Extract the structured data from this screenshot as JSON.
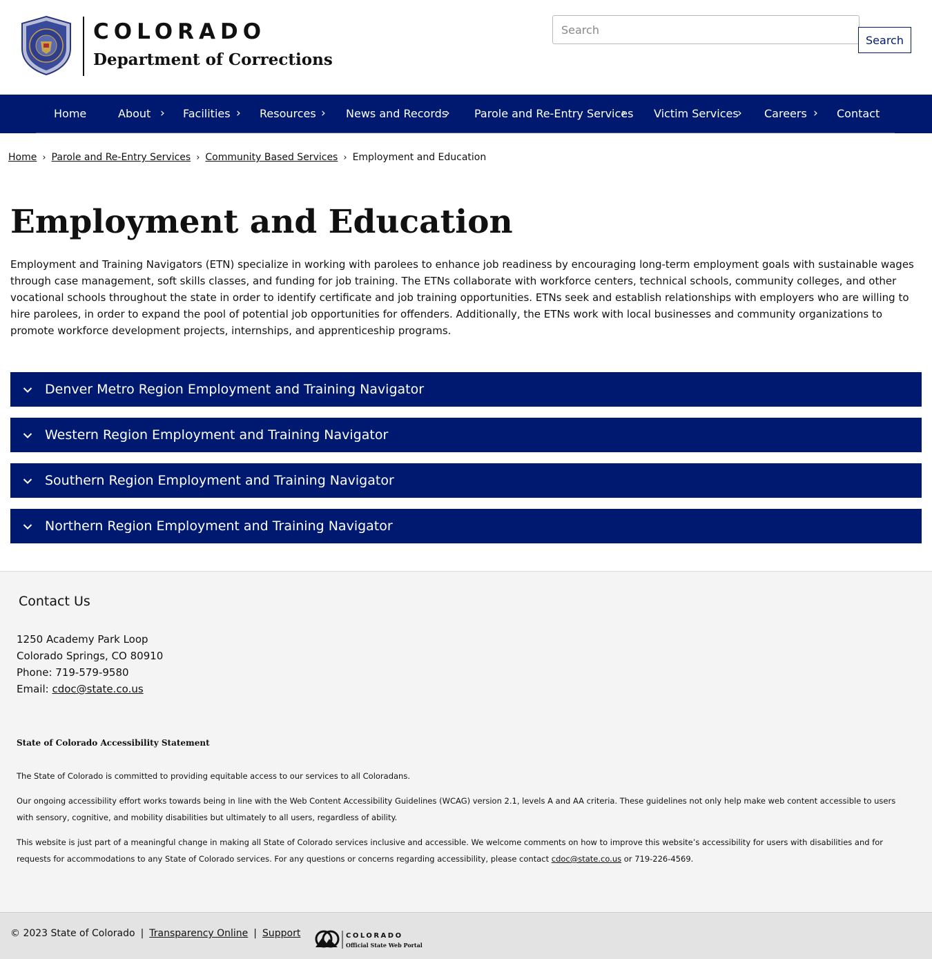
{
  "header": {
    "state_name": "COLORADO",
    "department": "Department of Corrections",
    "search_placeholder": "Search",
    "search_button": "Search"
  },
  "nav": {
    "items": [
      {
        "label": "Home",
        "has_submenu": false
      },
      {
        "label": "About",
        "has_submenu": true
      },
      {
        "label": "Facilities",
        "has_submenu": true
      },
      {
        "label": "Resources",
        "has_submenu": true
      },
      {
        "label": "News and Records",
        "has_submenu": true
      },
      {
        "label": "Parole and Re-Entry Services",
        "has_submenu": true
      },
      {
        "label": "Victim Services",
        "has_submenu": true
      },
      {
        "label": "Careers",
        "has_submenu": true
      },
      {
        "label": "Contact",
        "has_submenu": false
      }
    ]
  },
  "breadcrumb": {
    "items": [
      "Home",
      "Parole and Re-Entry Services",
      "Community Based Services"
    ],
    "current": "Employment and Education"
  },
  "main": {
    "title": "Employment and Education",
    "intro": "Employment and Training Navigators (ETN) specialize in working with parolees to enhance job readiness by encouraging long-term employment goals with sustainable wages through case management, soft skills classes, and funding for job training. The ETNs collaborate with workforce centers, technical schools, community colleges, and other vocational schools throughout the state in order to identify certificate and job training opportunities. ETNs seek and establish relationships with employers who are willing to hire parolees, in order to expand the pool of potential job opportunities for offenders. Additionally, the ETNs work with local businesses and community organizations to promote workforce development projects, internships, and apprenticeship programs.",
    "accordions": [
      "Denver Metro Region Employment and Training Navigator",
      "Western Region Employment and Training Navigator",
      "Southern Region Employment and Training Navigator",
      "Northern Region Employment and Training Navigator"
    ]
  },
  "footer": {
    "contact_heading": "Contact Us",
    "address_line1": "1250 Academy Park Loop",
    "address_line2": "Colorado Springs, CO 80910",
    "phone": "Phone: 719-579-9580",
    "email_label": "Email: ",
    "email": "cdoc@state.co.us",
    "accessibility": {
      "heading": "State of Colorado Accessibility Statement",
      "p1": "The State of Colorado is committed to providing equitable access to our services to all Coloradans.",
      "p2": "Our ongoing accessibility effort works towards being in line with the Web Content Accessibility Guidelines (WCAG) version 2.1, levels A and AA criteria. These guidelines not only help make web content accessible to users with sensory, cognitive, and mobility disabilities but ultimately to all users, regardless of ability.",
      "p3_before": "This website is just part of a meaningful change in making all State of Colorado services inclusive and accessible. We welcome comments on how to improve this website’s accessibility for users with disabilities and for requests for accommodations to any State of Colorado services. For any questions or concerns regarding accessibility, please contact ",
      "p3_email": "cdoc@state.co.us",
      "p3_after": " or 719-226-4569."
    }
  },
  "bottom": {
    "copyright": "© 2023 State of Colorado",
    "separator": "|",
    "link1": "Transparency Online",
    "link2": "Support",
    "portal_name": "COLORADO",
    "portal_sub": "Official State Web Portal"
  },
  "colors": {
    "nav_blue": "#001970",
    "footer_bg": "#f4f4f4",
    "bottom_bg": "#e3e3e3"
  },
  "icons": {
    "seal": "department-seal-icon",
    "nav_chevron": "chevron-right-icon",
    "accordion_chevron": "chevron-down-icon",
    "portal_logo": "colorado-portal-logo"
  }
}
